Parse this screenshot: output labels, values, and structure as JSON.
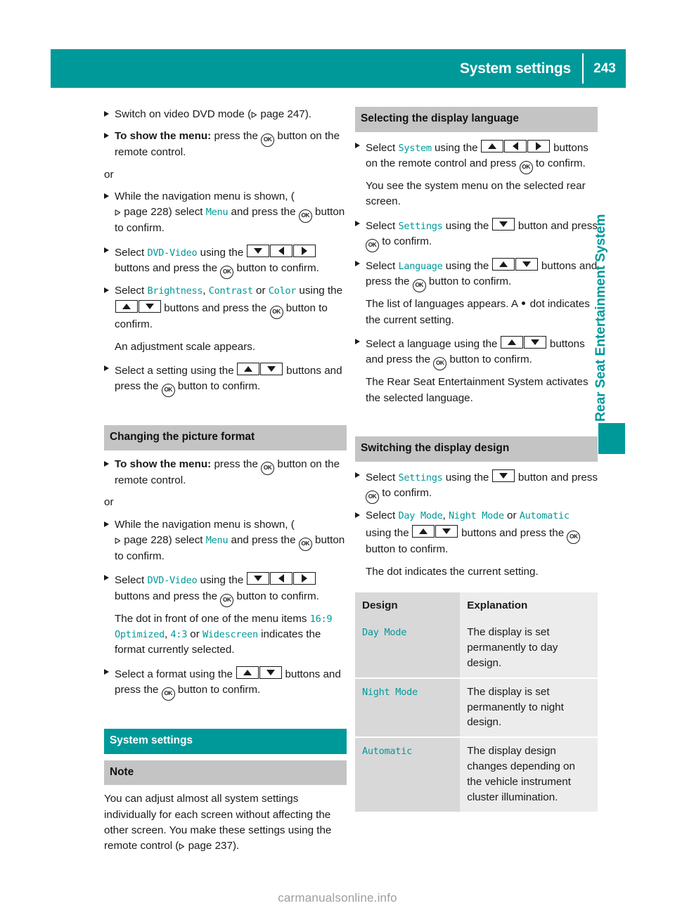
{
  "header": {
    "title": "System settings",
    "page_number": "243"
  },
  "side_tab": {
    "label": "Rear Seat Entertainment System"
  },
  "left_column": {
    "block1": {
      "steps": [
        {
          "parts": [
            {
              "t": "text",
              "v": "Switch on video DVD mode ("
            },
            {
              "t": "pgref",
              "v": "page 247"
            },
            {
              "t": "text",
              "v": ")."
            }
          ]
        },
        {
          "parts": [
            {
              "t": "bold",
              "v": "To show the menu:"
            },
            {
              "t": "text",
              "v": " press the "
            },
            {
              "t": "ok"
            },
            {
              "t": "text",
              "v": " button on the remote control."
            }
          ]
        }
      ],
      "or_label": "or",
      "steps2": [
        {
          "parts": [
            {
              "t": "text",
              "v": "While the navigation menu is shown, ("
            },
            {
              "t": "pgref",
              "v": "page 228"
            },
            {
              "t": "text",
              "v": ") select "
            },
            {
              "t": "ui",
              "v": "Menu"
            },
            {
              "t": "text",
              "v": " and press the "
            },
            {
              "t": "ok"
            },
            {
              "t": "text",
              "v": " button to confirm."
            }
          ]
        },
        {
          "parts": [
            {
              "t": "text",
              "v": "Select "
            },
            {
              "t": "ui",
              "v": "DVD-Video"
            },
            {
              "t": "text",
              "v": " using the "
            },
            {
              "t": "key",
              "v": "down"
            },
            {
              "t": "key",
              "v": "left"
            },
            {
              "t": "key",
              "v": "right"
            },
            {
              "t": "text",
              "v": " buttons and press the "
            },
            {
              "t": "ok"
            },
            {
              "t": "text",
              "v": " button to confirm."
            }
          ]
        },
        {
          "parts": [
            {
              "t": "text",
              "v": "Select "
            },
            {
              "t": "ui",
              "v": "Brightness"
            },
            {
              "t": "text",
              "v": ", "
            },
            {
              "t": "ui",
              "v": "Contrast"
            },
            {
              "t": "text",
              "v": " or "
            },
            {
              "t": "ui",
              "v": "Color"
            },
            {
              "t": "text",
              "v": " using the "
            },
            {
              "t": "key",
              "v": "up"
            },
            {
              "t": "key",
              "v": "down"
            },
            {
              "t": "text",
              "v": " buttons and press the "
            },
            {
              "t": "ok"
            },
            {
              "t": "text",
              "v": " button to confirm."
            }
          ],
          "note": "An adjustment scale appears."
        },
        {
          "parts": [
            {
              "t": "text",
              "v": "Select a setting using the "
            },
            {
              "t": "key",
              "v": "up"
            },
            {
              "t": "key",
              "v": "down"
            },
            {
              "t": "text",
              "v": " buttons and press the "
            },
            {
              "t": "ok"
            },
            {
              "t": "text",
              "v": " button to confirm."
            }
          ]
        }
      ]
    },
    "block2": {
      "heading": "Changing the picture format",
      "steps": [
        {
          "parts": [
            {
              "t": "bold",
              "v": "To show the menu:"
            },
            {
              "t": "text",
              "v": " press the "
            },
            {
              "t": "ok"
            },
            {
              "t": "text",
              "v": " button on the remote control."
            }
          ]
        }
      ],
      "or_label": "or",
      "steps2": [
        {
          "parts": [
            {
              "t": "text",
              "v": "While the navigation menu is shown, ("
            },
            {
              "t": "pgref",
              "v": "page 228"
            },
            {
              "t": "text",
              "v": ") select "
            },
            {
              "t": "ui",
              "v": "Menu"
            },
            {
              "t": "text",
              "v": " and press the "
            },
            {
              "t": "ok"
            },
            {
              "t": "text",
              "v": " button to confirm."
            }
          ]
        },
        {
          "parts": [
            {
              "t": "text",
              "v": "Select "
            },
            {
              "t": "ui",
              "v": "DVD-Video"
            },
            {
              "t": "text",
              "v": " using the "
            },
            {
              "t": "key",
              "v": "down"
            },
            {
              "t": "key",
              "v": "left"
            },
            {
              "t": "key",
              "v": "right"
            },
            {
              "t": "text",
              "v": " buttons and press the "
            },
            {
              "t": "ok"
            },
            {
              "t": "text",
              "v": " button to confirm."
            }
          ],
          "note_parts": [
            {
              "t": "text",
              "v": "The dot in front of one of the menu items "
            },
            {
              "t": "ui",
              "v": "16:9 Optimized"
            },
            {
              "t": "text",
              "v": ", "
            },
            {
              "t": "ui",
              "v": "4:3"
            },
            {
              "t": "text",
              "v": " or "
            },
            {
              "t": "ui",
              "v": "Widescreen"
            },
            {
              "t": "text",
              "v": " indicates the format currently selected."
            }
          ]
        },
        {
          "parts": [
            {
              "t": "text",
              "v": "Select a format using the "
            },
            {
              "t": "key",
              "v": "up"
            },
            {
              "t": "key",
              "v": "down"
            },
            {
              "t": "text",
              "v": " buttons and press the "
            },
            {
              "t": "ok"
            },
            {
              "t": "text",
              "v": " button to confirm."
            }
          ]
        }
      ]
    },
    "block3": {
      "heading_teal": "System settings",
      "heading_note": "Note",
      "note_parts": [
        {
          "t": "text",
          "v": "You can adjust almost all system settings individually for each screen without affecting the other screen. You make these settings using the remote control ("
        },
        {
          "t": "pgref",
          "v": "page 237"
        },
        {
          "t": "text",
          "v": ")."
        }
      ]
    }
  },
  "right_column": {
    "block1": {
      "heading": "Selecting the display language",
      "steps": [
        {
          "parts": [
            {
              "t": "text",
              "v": "Select "
            },
            {
              "t": "ui",
              "v": "System"
            },
            {
              "t": "text",
              "v": " using the "
            },
            {
              "t": "key",
              "v": "up"
            },
            {
              "t": "key",
              "v": "left"
            },
            {
              "t": "key",
              "v": "right"
            },
            {
              "t": "text",
              "v": " buttons on the remote control and press "
            },
            {
              "t": "ok"
            },
            {
              "t": "text",
              "v": " to confirm."
            }
          ],
          "note": "You see the system menu on the selected rear screen."
        },
        {
          "parts": [
            {
              "t": "text",
              "v": "Select "
            },
            {
              "t": "ui",
              "v": "Settings"
            },
            {
              "t": "text",
              "v": " using the "
            },
            {
              "t": "key",
              "v": "down"
            },
            {
              "t": "text",
              "v": " button and press "
            },
            {
              "t": "ok"
            },
            {
              "t": "text",
              "v": " to confirm."
            }
          ]
        },
        {
          "parts": [
            {
              "t": "text",
              "v": "Select "
            },
            {
              "t": "ui",
              "v": "Language"
            },
            {
              "t": "text",
              "v": " using the "
            },
            {
              "t": "key",
              "v": "up"
            },
            {
              "t": "key",
              "v": "down"
            },
            {
              "t": "text",
              "v": " buttons and press the "
            },
            {
              "t": "ok"
            },
            {
              "t": "text",
              "v": " button to confirm."
            }
          ],
          "note_parts": [
            {
              "t": "text",
              "v": "The list of languages appears. A "
            },
            {
              "t": "dot"
            },
            {
              "t": "text",
              "v": " dot indicates the current setting."
            }
          ]
        },
        {
          "parts": [
            {
              "t": "text",
              "v": "Select a language using the "
            },
            {
              "t": "key",
              "v": "up"
            },
            {
              "t": "key",
              "v": "down"
            },
            {
              "t": "text",
              "v": " buttons and press the "
            },
            {
              "t": "ok"
            },
            {
              "t": "text",
              "v": " button to confirm."
            }
          ],
          "note": "The Rear Seat Entertainment System activates the selected language."
        }
      ]
    },
    "block2": {
      "heading": "Switching the display design",
      "steps": [
        {
          "parts": [
            {
              "t": "text",
              "v": "Select "
            },
            {
              "t": "ui",
              "v": "Settings"
            },
            {
              "t": "text",
              "v": " using the "
            },
            {
              "t": "key",
              "v": "down"
            },
            {
              "t": "text",
              "v": " button and press "
            },
            {
              "t": "ok"
            },
            {
              "t": "text",
              "v": " to confirm."
            }
          ]
        },
        {
          "parts": [
            {
              "t": "text",
              "v": "Select "
            },
            {
              "t": "ui",
              "v": "Day Mode"
            },
            {
              "t": "text",
              "v": ", "
            },
            {
              "t": "ui",
              "v": "Night Mode"
            },
            {
              "t": "text",
              "v": " or "
            },
            {
              "t": "ui",
              "v": "Automatic"
            },
            {
              "t": "text",
              "v": " using the "
            },
            {
              "t": "key",
              "v": "up"
            },
            {
              "t": "key",
              "v": "down"
            },
            {
              "t": "text",
              "v": " buttons and press the "
            },
            {
              "t": "ok"
            },
            {
              "t": "text",
              "v": " button to confirm."
            }
          ],
          "note": "The dot indicates the current setting."
        }
      ],
      "table": {
        "headers": [
          "Design",
          "Explanation"
        ],
        "rows": [
          {
            "design": "Day Mode",
            "explanation": "The display is set permanently to day design."
          },
          {
            "design": "Night Mode",
            "explanation": "The display is set permanently to night design."
          },
          {
            "design": "Automatic",
            "explanation": "The display design changes depending on the vehicle instrument cluster illumination."
          }
        ]
      }
    }
  },
  "footer": {
    "watermark": "carmanualsonline.info"
  },
  "colors": {
    "teal": "#00999A",
    "heading_gray": "#c4c4c4",
    "table_col1": "#d8d8d8",
    "table_col2": "#ececec",
    "text": "#1a1a1a"
  }
}
